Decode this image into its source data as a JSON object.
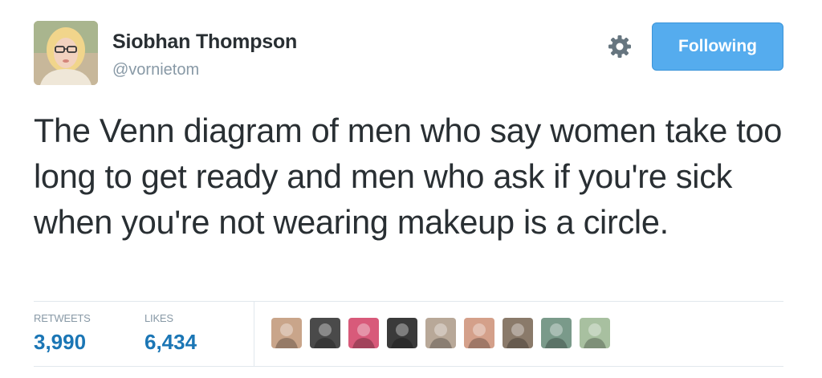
{
  "author": {
    "display_name": "Siobhan Thompson",
    "handle": "@vornietom",
    "avatar_icon": "user-avatar-photo"
  },
  "actions": {
    "settings_icon": "gear-icon",
    "follow_label": "Following",
    "follow_color": "#55acee"
  },
  "tweet": {
    "text": "The Venn diagram of men who say women take too long to get ready and men who ask if you're sick when you're not wearing makeup is a circle."
  },
  "stats": {
    "retweets_label": "RETWEETS",
    "retweets_count": "3,990",
    "likes_label": "LIKES",
    "likes_count": "6,434",
    "count_color": "#1b76b5"
  },
  "likers": [
    {
      "icon": "liker-avatar-1",
      "color": "#c9a58a"
    },
    {
      "icon": "liker-avatar-2",
      "color": "#4a4a4a"
    },
    {
      "icon": "liker-avatar-3",
      "color": "#d85a7a"
    },
    {
      "icon": "liker-avatar-4",
      "color": "#3a3a3a"
    },
    {
      "icon": "liker-avatar-5",
      "color": "#b8a898"
    },
    {
      "icon": "liker-avatar-6",
      "color": "#d4a08a"
    },
    {
      "icon": "liker-avatar-7",
      "color": "#8a7a6a"
    },
    {
      "icon": "liker-avatar-8",
      "color": "#7a9a8a"
    },
    {
      "icon": "liker-avatar-9",
      "color": "#a8c0a0"
    }
  ]
}
